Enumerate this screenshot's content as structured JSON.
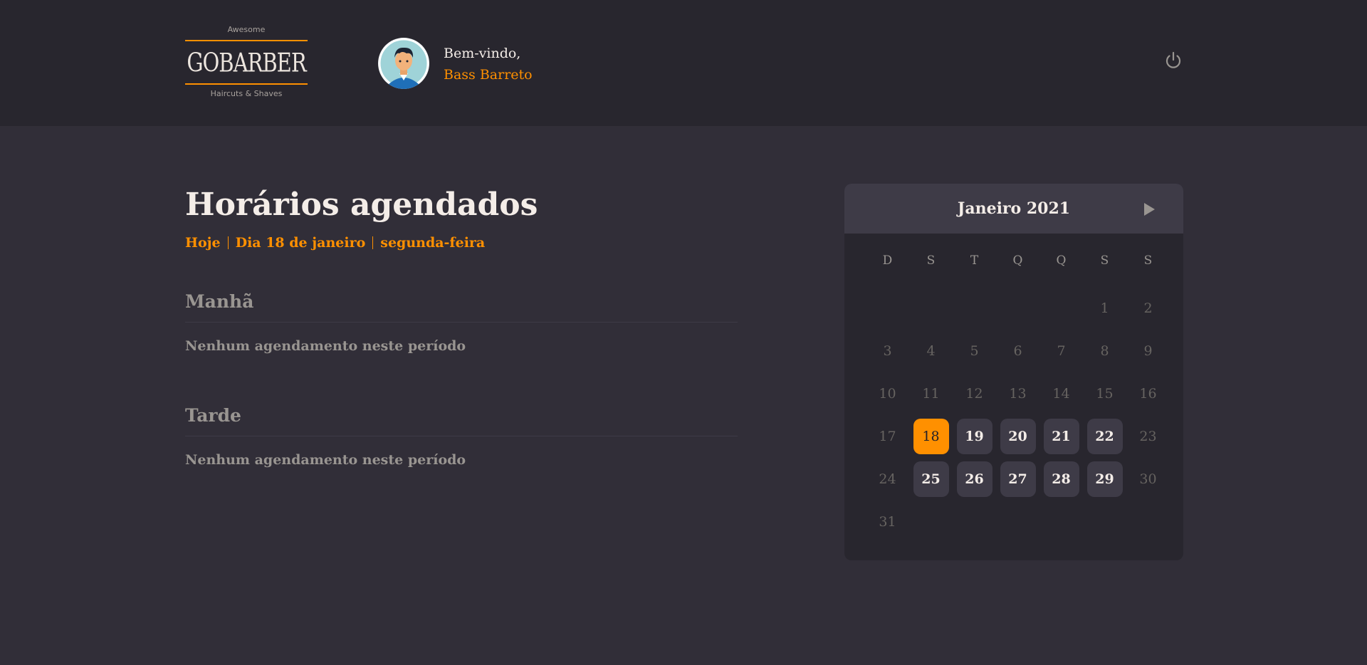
{
  "header": {
    "logo": {
      "top": "Awesome",
      "name": "GOBARBER",
      "bottom": "Haircuts & Shaves"
    },
    "welcome_label": "Bem-vindo,",
    "user_name": "Bass Barreto"
  },
  "schedule": {
    "title": "Horários agendados",
    "today": "Hoje",
    "date": "Dia 18 de janeiro",
    "weekday": "segunda-feira",
    "morning": {
      "title": "Manhã",
      "empty": "Nenhum agendamento neste período"
    },
    "afternoon": {
      "title": "Tarde",
      "empty": "Nenhum agendamento neste período"
    }
  },
  "calendar": {
    "month_label": "Janeiro 2021",
    "weekdays": [
      "D",
      "S",
      "T",
      "Q",
      "Q",
      "S",
      "S"
    ],
    "weeks": [
      [
        "",
        "",
        "",
        "",
        "",
        "1",
        "2"
      ],
      [
        "3",
        "4",
        "5",
        "6",
        "7",
        "8",
        "9"
      ],
      [
        "10",
        "11",
        "12",
        "13",
        "14",
        "15",
        "16"
      ],
      [
        "17",
        "18",
        "19",
        "20",
        "21",
        "22",
        "23"
      ],
      [
        "24",
        "25",
        "26",
        "27",
        "28",
        "29",
        "30"
      ],
      [
        "31",
        "",
        "",
        "",
        "",
        "",
        ""
      ]
    ],
    "available_days": [
      "18",
      "19",
      "20",
      "21",
      "22",
      "25",
      "26",
      "27",
      "28",
      "29"
    ],
    "selected_day": "18"
  },
  "colors": {
    "accent": "#ff9000",
    "background": "#312e38",
    "header": "#28262e",
    "text": "#f4ede8",
    "muted": "#999591"
  }
}
